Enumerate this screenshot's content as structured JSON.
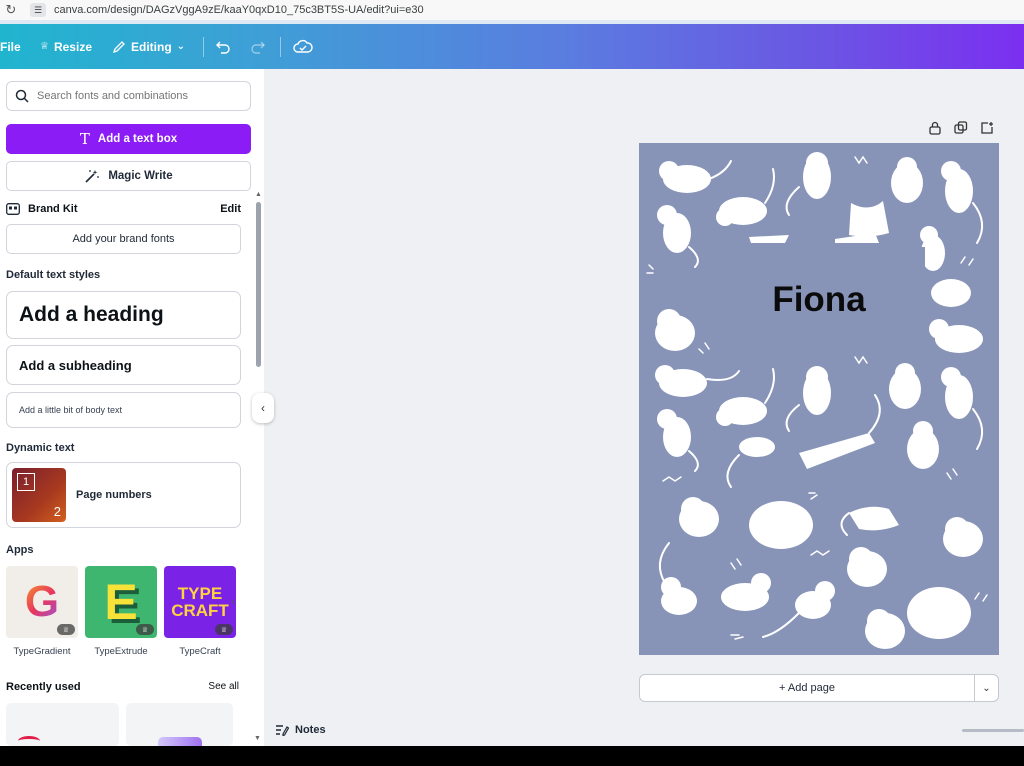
{
  "browser": {
    "url": "canva.com/design/DAGzVggA9zE/kaaY0qxD10_75c3BT5S-UA/edit?ui=e30"
  },
  "toolbar": {
    "file_label": "File",
    "resize_label": "Resize",
    "editing_label": "Editing",
    "accent_start": "#20b5cf",
    "accent_end": "#7b2ff0"
  },
  "panel": {
    "search_placeholder": "Search fonts and combinations",
    "add_text_box": "Add a text box",
    "magic_write": "Magic Write",
    "brand_kit": "Brand Kit",
    "brand_edit": "Edit",
    "add_brand_fonts": "Add your brand fonts",
    "default_text_styles": "Default text styles",
    "heading": "Add a heading",
    "subheading": "Add a subheading",
    "body_text": "Add a little bit of body text",
    "dynamic_text": "Dynamic text",
    "page_numbers": "Page numbers",
    "page_numbers_thumb": [
      "1",
      "2"
    ],
    "apps_label": "Apps",
    "apps": [
      {
        "name": "TypeGradient",
        "icon": "typegradient-icon",
        "glyph": "G"
      },
      {
        "name": "TypeExtrude",
        "icon": "typeextrude-icon",
        "glyph": "E"
      },
      {
        "name": "TypeCraft",
        "icon": "typecraft-icon",
        "glyph": "TYPE CRAFT"
      }
    ],
    "recently_used": "Recently used",
    "see_all": "See all",
    "primary_color": "#8b1cf6"
  },
  "canvas": {
    "name_text": "Fiona",
    "page_color": "#8794b8",
    "add_page": "+ Add page"
  },
  "footer": {
    "notes": "Notes"
  }
}
